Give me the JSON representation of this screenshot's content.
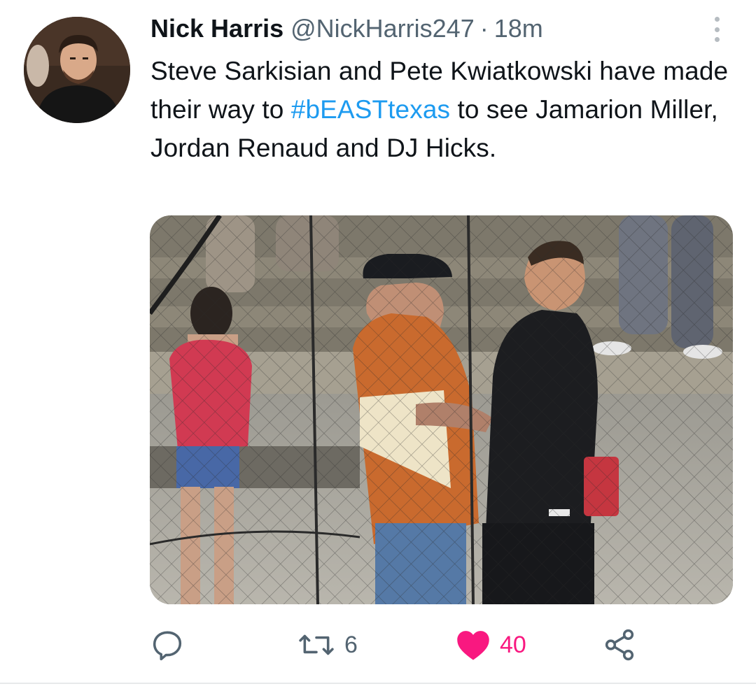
{
  "tweet": {
    "author": {
      "name": "Nick Harris",
      "handle": "@NickHarris247",
      "separator": "·",
      "time": "18m",
      "avatar_icon": "user-avatar"
    },
    "text_before": "Steve Sarkisian and Pete Kwiatkowski have made their way to ",
    "hashtag": "#bEASTtexas",
    "text_after": " to see Jamarion Miller, Jordan Renaud and DJ Hicks.",
    "media_description": "photo",
    "actions": {
      "reply": {
        "icon": "reply-icon",
        "count": ""
      },
      "retweet": {
        "icon": "retweet-icon",
        "count": "6"
      },
      "like": {
        "icon": "heart-icon",
        "count": "40",
        "liked": true
      },
      "share": {
        "icon": "share-icon",
        "count": ""
      }
    },
    "colors": {
      "text": "#0f1419",
      "secondary": "#536471",
      "link": "#1d9bf0",
      "like": "#f91880"
    }
  }
}
